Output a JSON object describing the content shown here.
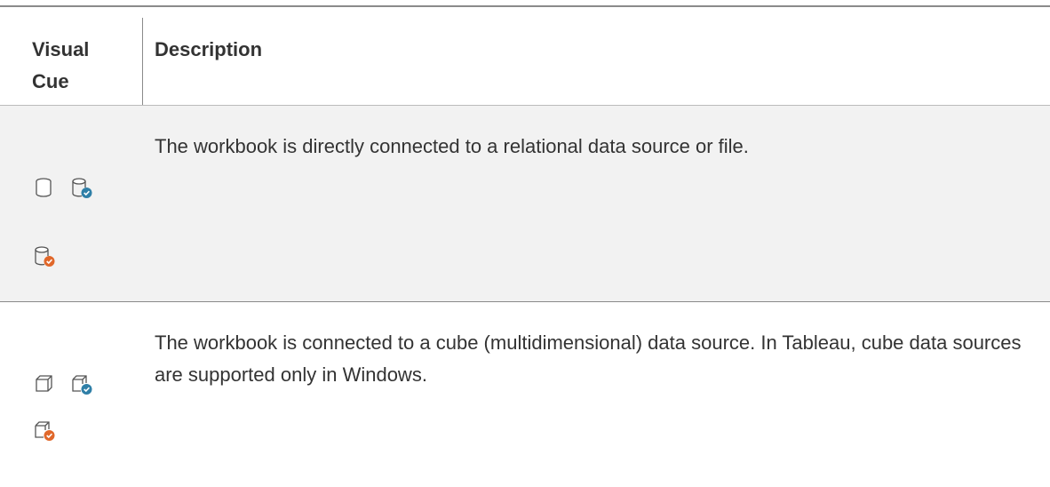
{
  "table": {
    "headers": {
      "visual_cue": "Visual Cue",
      "description": "Description"
    },
    "rows": [
      {
        "icons": [
          "database-icon",
          "database-connected-blue-icon",
          "database-connected-orange-icon"
        ],
        "description": "The workbook is directly connected to a relational data source or file."
      },
      {
        "icons": [
          "cube-icon",
          "cube-connected-blue-icon",
          "cube-connected-orange-icon"
        ],
        "description": "The workbook is connected to a cube (multidimensional) data source. In Tableau, cube data sources are supported only in Windows."
      }
    ]
  },
  "colors": {
    "blue_badge": "#2f7fa7",
    "orange_badge": "#e0672a",
    "icon_stroke": "#555555",
    "row_shade": "#f2f2f2"
  }
}
